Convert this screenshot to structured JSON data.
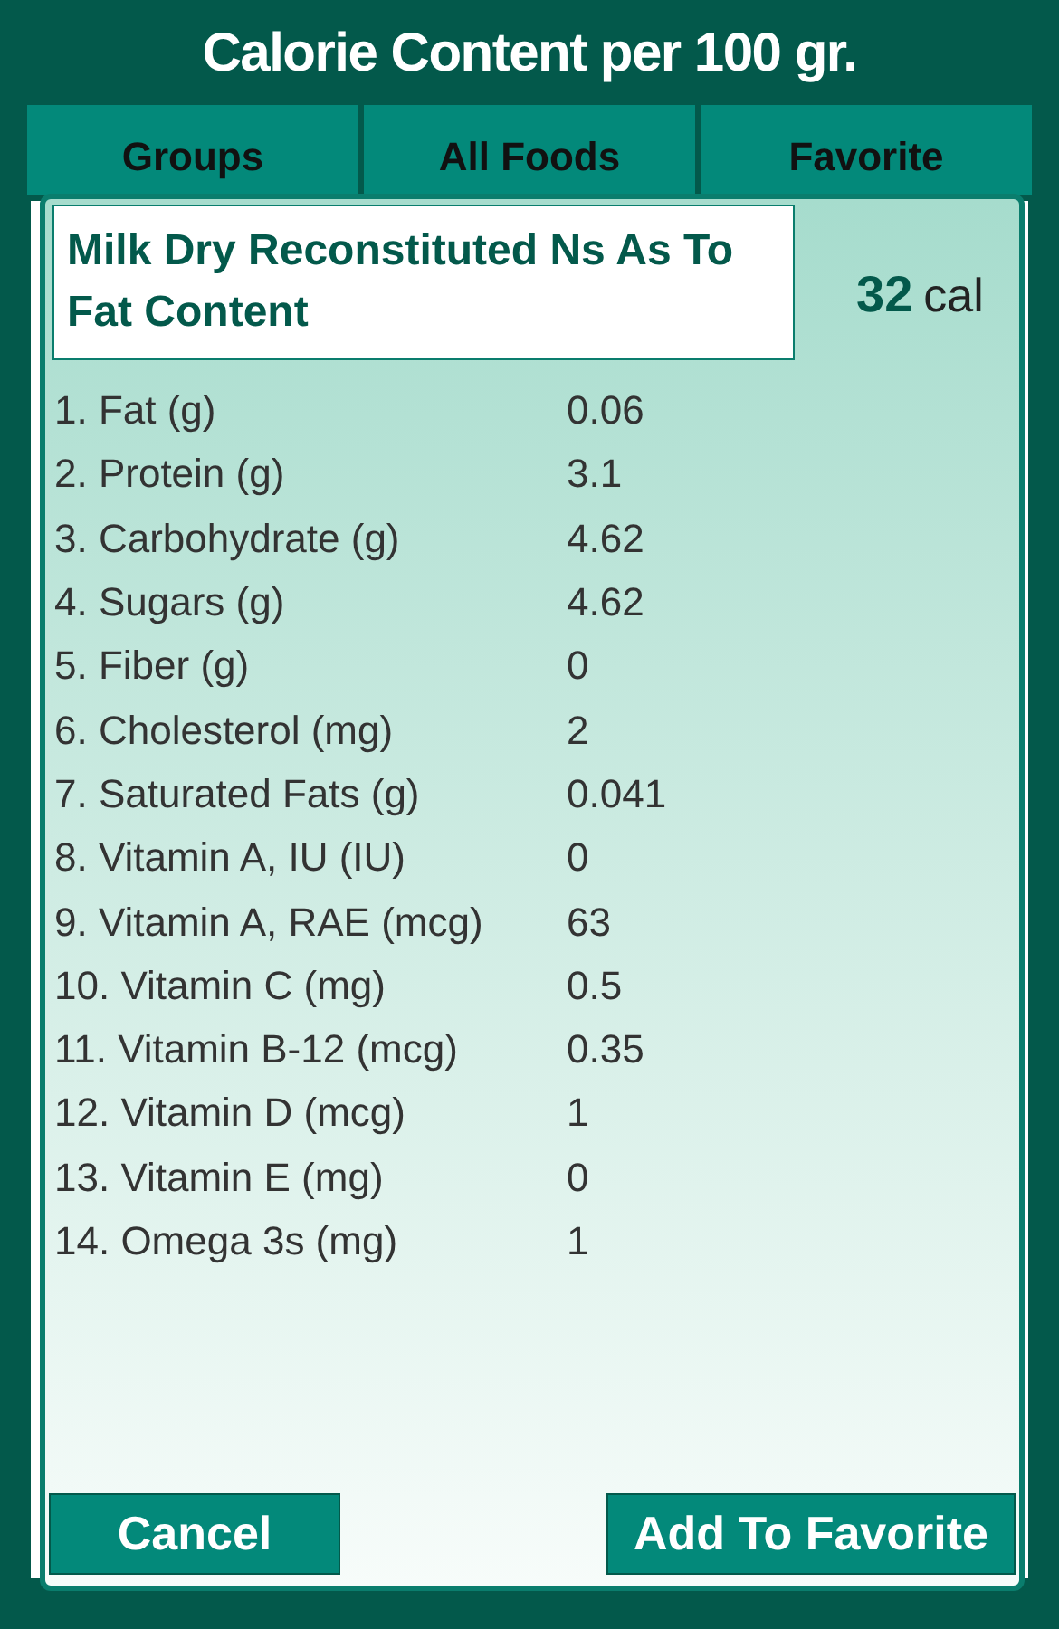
{
  "header": {
    "title": "Calorie Content per 100 gr."
  },
  "tabs": [
    {
      "label": "Groups"
    },
    {
      "label": "All Foods"
    },
    {
      "label": "Favorite"
    }
  ],
  "dialog": {
    "food_name": "Milk Dry Reconstituted Ns As To Fat Content",
    "calories": "32",
    "calories_unit": "cal",
    "nutrients": [
      {
        "label": "1. Fat (g)",
        "value": "0.06"
      },
      {
        "label": "2. Protein (g)",
        "value": "3.1"
      },
      {
        "label": "3. Carbohydrate (g)",
        "value": "4.62"
      },
      {
        "label": "4. Sugars (g)",
        "value": "4.62"
      },
      {
        "label": "5. Fiber (g)",
        "value": "0"
      },
      {
        "label": "6. Cholesterol (mg)",
        "value": "2"
      },
      {
        "label": "7. Saturated Fats (g)",
        "value": "0.041"
      },
      {
        "label": "8. Vitamin A, IU (IU)",
        "value": "0"
      },
      {
        "label": "9. Vitamin A, RAE (mcg)",
        "value": "63"
      },
      {
        "label": "10. Vitamin C (mg)",
        "value": "0.5"
      },
      {
        "label": "11. Vitamin B-12 (mcg)",
        "value": "0.35"
      },
      {
        "label": "12. Vitamin D (mcg)",
        "value": "1"
      },
      {
        "label": "13. Vitamin E (mg)",
        "value": "0"
      },
      {
        "label": "14. Omega 3s (mg)",
        "value": "1"
      }
    ],
    "buttons": [
      "Cancel",
      "Add To Favorite"
    ]
  }
}
